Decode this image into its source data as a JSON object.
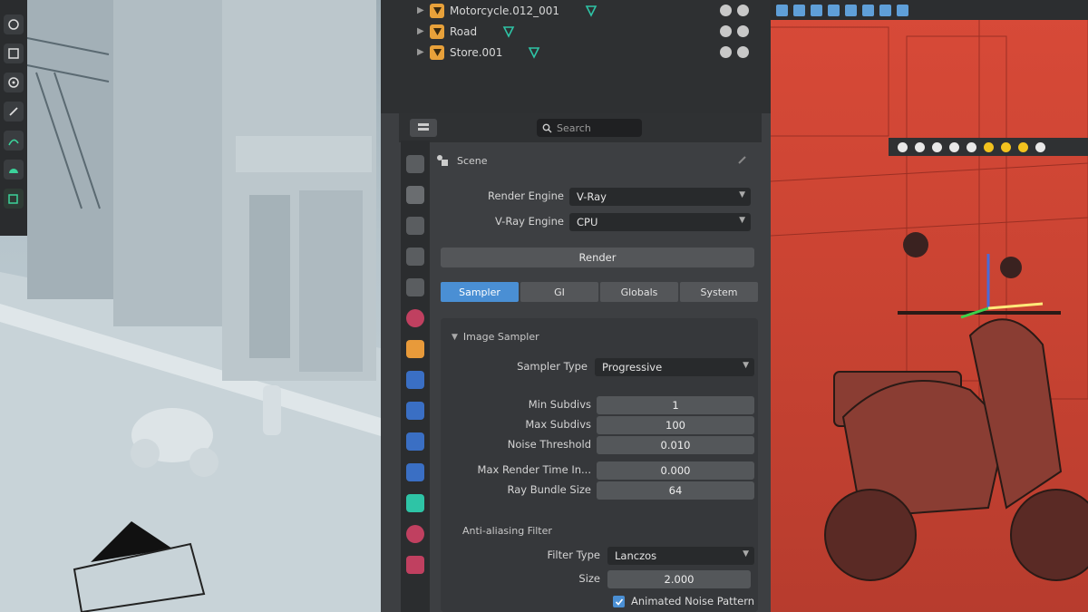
{
  "outliner": {
    "items": [
      {
        "label": "Motorcycle.012_001"
      },
      {
        "label": "Road"
      },
      {
        "label": "Store.001"
      }
    ]
  },
  "properties": {
    "search_placeholder": "Search",
    "scene_label": "Scene",
    "render_engine_label": "Render Engine",
    "render_engine_value": "V-Ray",
    "vray_engine_label": "V-Ray Engine",
    "vray_engine_value": "CPU",
    "render_button": "Render",
    "tabs": [
      {
        "label": "Sampler",
        "active": true
      },
      {
        "label": "GI",
        "active": false
      },
      {
        "label": "Globals",
        "active": false
      },
      {
        "label": "System",
        "active": false
      }
    ],
    "image_sampler": {
      "header": "Image Sampler",
      "sampler_type_label": "Sampler Type",
      "sampler_type_value": "Progressive",
      "min_subdivs_label": "Min Subdivs",
      "min_subdivs_value": "1",
      "max_subdivs_label": "Max Subdivs",
      "max_subdivs_value": "100",
      "noise_threshold_label": "Noise Threshold",
      "noise_threshold_value": "0.010",
      "max_render_time_label": "Max Render Time In...",
      "max_render_time_value": "0.000",
      "ray_bundle_label": "Ray Bundle Size",
      "ray_bundle_value": "64"
    },
    "antialiasing": {
      "header": "Anti-aliasing Filter",
      "filter_type_label": "Filter Type",
      "filter_type_value": "Lanczos",
      "size_label": "Size",
      "size_value": "2.000",
      "animated_noise_label": "Animated Noise Pattern"
    }
  },
  "colors": {
    "accent": "#4a8fd4",
    "object_icon": "#e8a13a",
    "modifier_icon": "#2ec4a6",
    "wireframe_bg": "#c94332"
  }
}
